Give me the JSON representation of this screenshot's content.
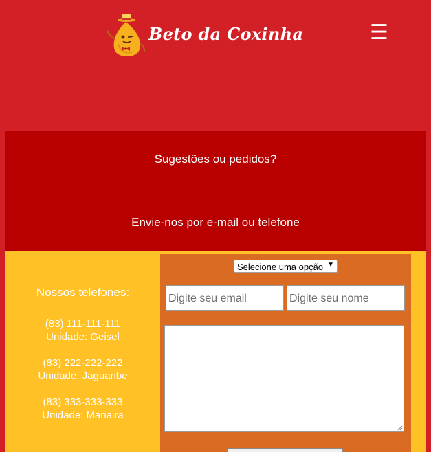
{
  "header": {
    "logo_text": "Beto da Coxinha",
    "menu_icon": "☰"
  },
  "banner": {
    "line1": "Sugestões ou pedidos?",
    "line2": "Envie-nos por e-mail ou telefone"
  },
  "phones": {
    "title": "Nossos telefones:",
    "items": [
      {
        "number": "(83) 111-111-111",
        "unit": "Unidade: Geisel"
      },
      {
        "number": "(83) 222-222-222",
        "unit": "Unidade: Jaguaribe"
      },
      {
        "number": "(83) 333-333-333",
        "unit": "Unidade: Manaira"
      }
    ]
  },
  "form": {
    "select_label": "Selecione uma opção",
    "email_placeholder": "Digite seu email",
    "name_placeholder": "Digite seu nome"
  },
  "colors": {
    "header_red": "#d32027",
    "band_red": "#b80000",
    "contact_yellow": "#ffc125",
    "form_orange": "#d96b22"
  }
}
